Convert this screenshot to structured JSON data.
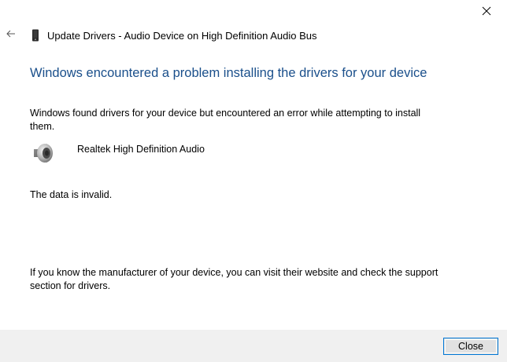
{
  "window": {
    "title": "Update Drivers - Audio Device on High Definition Audio Bus",
    "close_icon": "close-icon",
    "back_icon": "back-arrow-icon",
    "device_icon": "phone-device-icon"
  },
  "content": {
    "heading": "Windows encountered a problem installing the drivers for your device",
    "message": "Windows found drivers for your device but encountered an error while attempting to install them.",
    "device": {
      "icon": "speaker-icon",
      "name": "Realtek High Definition Audio"
    },
    "error": "The data is invalid.",
    "support": "If you know the manufacturer of your device, you can visit their website and check the support section for drivers."
  },
  "footer": {
    "close_label": "Close"
  },
  "colors": {
    "heading": "#1a4f8b",
    "footer_bg": "#f0f0f0",
    "button_border": "#0078d7",
    "button_bg": "#e1e1e1"
  }
}
